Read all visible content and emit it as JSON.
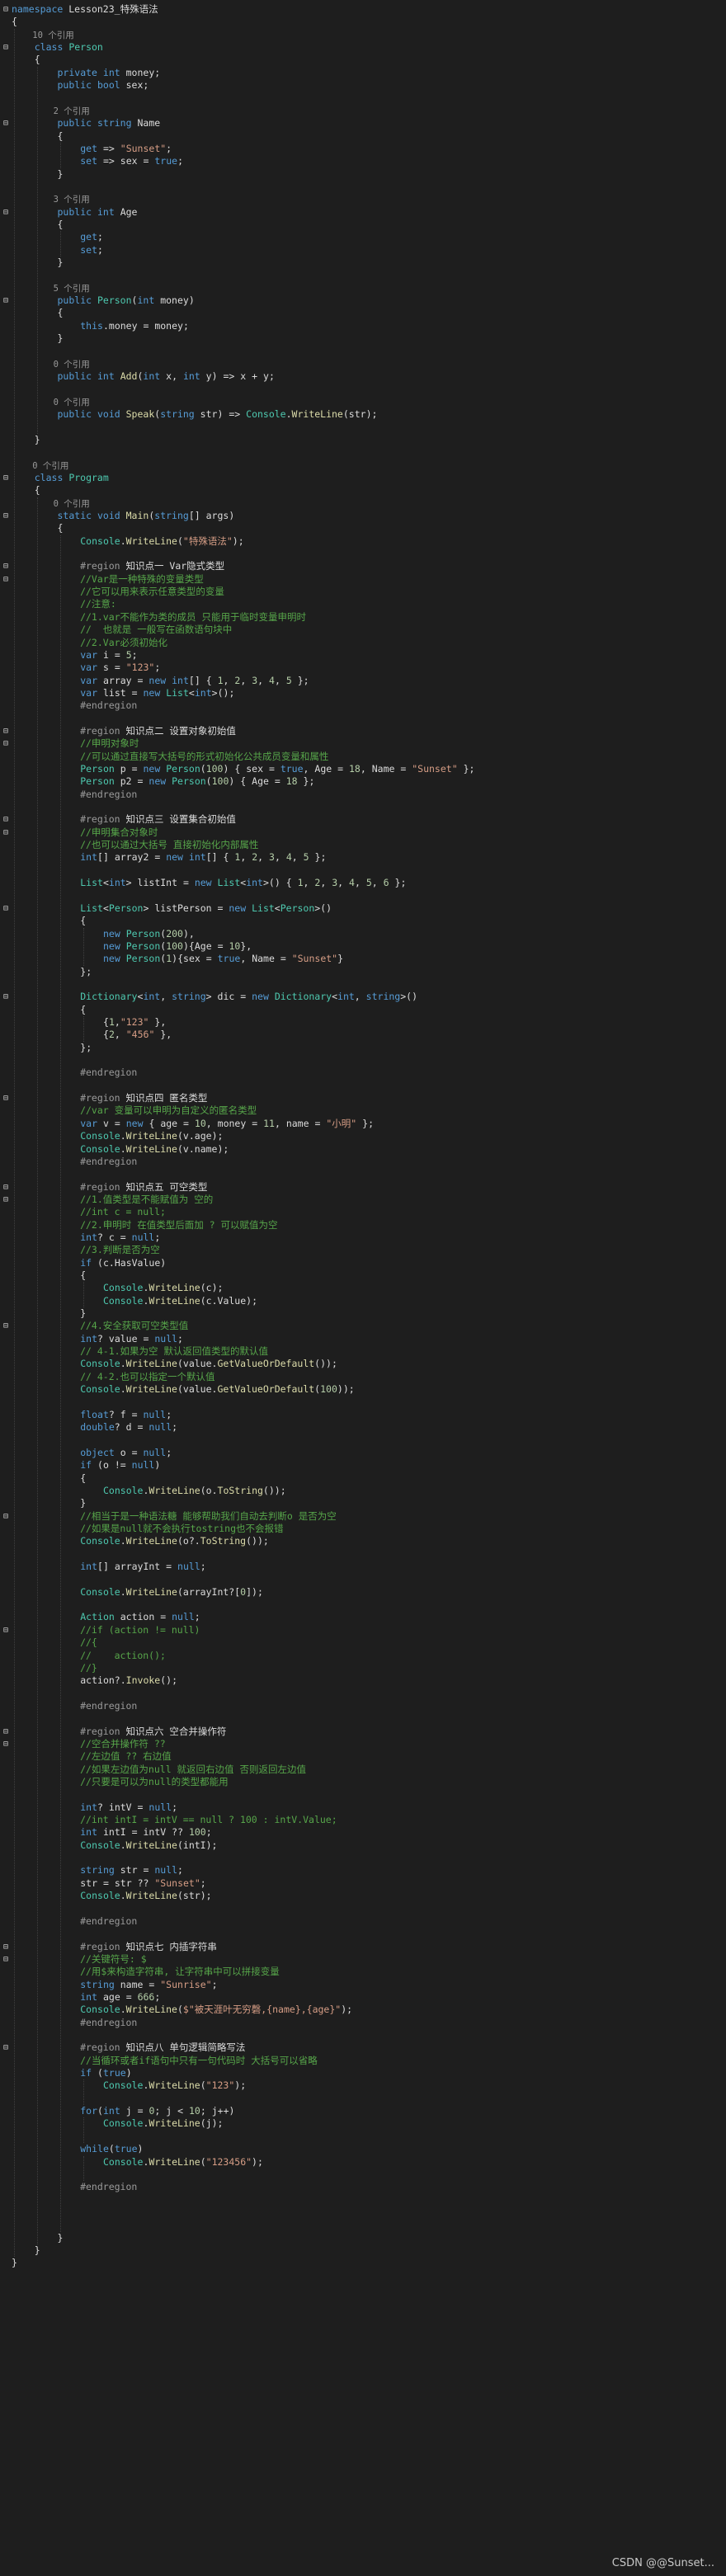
{
  "editor": {
    "theme": "dark",
    "background": "#1e1e1e",
    "lines": [
      {
        "text": "namespace Lesson23_特殊语法",
        "fold": "-"
      },
      {
        "text": "{"
      },
      {
        "text": "    10 个引用",
        "kind": "ref"
      },
      {
        "text": "    class Person",
        "fold": "-"
      },
      {
        "text": "    {"
      },
      {
        "text": "        private int money;"
      },
      {
        "text": "        public bool sex;"
      },
      {
        "text": ""
      },
      {
        "text": "        2 个引用",
        "kind": "ref"
      },
      {
        "text": "        public string Name",
        "fold": "-"
      },
      {
        "text": "        {"
      },
      {
        "text": "            get => \"Sunset\";"
      },
      {
        "text": "            set => sex = true;"
      },
      {
        "text": "        }"
      },
      {
        "text": ""
      },
      {
        "text": "        3 个引用",
        "kind": "ref"
      },
      {
        "text": "        public int Age",
        "fold": "-"
      },
      {
        "text": "        {"
      },
      {
        "text": "            get;"
      },
      {
        "text": "            set;"
      },
      {
        "text": "        }"
      },
      {
        "text": ""
      },
      {
        "text": "        5 个引用",
        "kind": "ref"
      },
      {
        "text": "        public Person(int money)",
        "fold": "-"
      },
      {
        "text": "        {"
      },
      {
        "text": "            this.money = money;"
      },
      {
        "text": "        }"
      },
      {
        "text": ""
      },
      {
        "text": "        0 个引用",
        "kind": "ref"
      },
      {
        "text": "        public int Add(int x, int y) => x + y;"
      },
      {
        "text": ""
      },
      {
        "text": "        0 个引用",
        "kind": "ref"
      },
      {
        "text": "        public void Speak(string str) => Console.WriteLine(str);"
      },
      {
        "text": ""
      },
      {
        "text": "    }"
      },
      {
        "text": ""
      },
      {
        "text": "    0 个引用",
        "kind": "ref"
      },
      {
        "text": "    class Program",
        "fold": "-"
      },
      {
        "text": "    {"
      },
      {
        "text": "        0 个引用",
        "kind": "ref"
      },
      {
        "text": "        static void Main(string[] args)",
        "fold": "-"
      },
      {
        "text": "        {"
      },
      {
        "text": "            Console.WriteLine(\"特殊语法\");"
      },
      {
        "text": ""
      },
      {
        "text": "            #region 知识点一 Var隐式类型",
        "kind": "pp",
        "fold": "-"
      },
      {
        "text": "            //Var是一种特殊的变量类型",
        "kind": "cm",
        "fold": "-"
      },
      {
        "text": "            //它可以用来表示任意类型的变量",
        "kind": "cm"
      },
      {
        "text": "            //注意:",
        "kind": "cm"
      },
      {
        "text": "            //1.var不能作为类的成员 只能用于临时变量申明时",
        "kind": "cm"
      },
      {
        "text": "            //  也就是 一般写在函数语句块中",
        "kind": "cm"
      },
      {
        "text": "            //2.Var必须初始化",
        "kind": "cm"
      },
      {
        "text": "            var i = 5;"
      },
      {
        "text": "            var s = \"123\";"
      },
      {
        "text": "            var array = new int[] { 1, 2, 3, 4, 5 };"
      },
      {
        "text": "            var list = new List<int>();"
      },
      {
        "text": "            #endregion",
        "kind": "pp"
      },
      {
        "text": ""
      },
      {
        "text": "            #region 知识点二 设置对象初始值",
        "kind": "pp",
        "fold": "-"
      },
      {
        "text": "            //申明对象时",
        "kind": "cm",
        "fold": "-"
      },
      {
        "text": "            //可以通过直接写大括号的形式初始化公共成员变量和属性",
        "kind": "cm"
      },
      {
        "text": "            Person p = new Person(100) { sex = true, Age = 18, Name = \"Sunset\" };"
      },
      {
        "text": "            Person p2 = new Person(100) { Age = 18 };"
      },
      {
        "text": "            #endregion",
        "kind": "pp"
      },
      {
        "text": ""
      },
      {
        "text": "            #region 知识点三 设置集合初始值",
        "kind": "pp",
        "fold": "-"
      },
      {
        "text": "            //申明集合对象时",
        "kind": "cm",
        "fold": "-"
      },
      {
        "text": "            //也可以通过大括号 直接初始化内部属性",
        "kind": "cm"
      },
      {
        "text": "            int[] array2 = new int[] { 1, 2, 3, 4, 5 };"
      },
      {
        "text": ""
      },
      {
        "text": "            List<int> listInt = new List<int>() { 1, 2, 3, 4, 5, 6 };"
      },
      {
        "text": ""
      },
      {
        "text": "            List<Person> listPerson = new List<Person>()",
        "fold": "-"
      },
      {
        "text": "            {"
      },
      {
        "text": "                new Person(200),"
      },
      {
        "text": "                new Person(100){Age = 10},"
      },
      {
        "text": "                new Person(1){sex = true, Name = \"Sunset\"}"
      },
      {
        "text": "            };"
      },
      {
        "text": ""
      },
      {
        "text": "            Dictionary<int, string> dic = new Dictionary<int, string>()",
        "fold": "-"
      },
      {
        "text": "            {"
      },
      {
        "text": "                {1,\"123\" },"
      },
      {
        "text": "                {2, \"456\" },"
      },
      {
        "text": "            };"
      },
      {
        "text": ""
      },
      {
        "text": "            #endregion",
        "kind": "pp"
      },
      {
        "text": ""
      },
      {
        "text": "            #region 知识点四 匿名类型",
        "kind": "pp",
        "fold": "-"
      },
      {
        "text": "            //var 变量可以申明为自定义的匿名类型",
        "kind": "cm"
      },
      {
        "text": "            var v = new { age = 10, money = 11, name = \"小明\" };"
      },
      {
        "text": "            Console.WriteLine(v.age);"
      },
      {
        "text": "            Console.WriteLine(v.name);"
      },
      {
        "text": "            #endregion",
        "kind": "pp"
      },
      {
        "text": ""
      },
      {
        "text": "            #region 知识点五 可空类型",
        "kind": "pp",
        "fold": "-"
      },
      {
        "text": "            //1.值类型是不能赋值为 空的",
        "kind": "cm",
        "fold": "-"
      },
      {
        "text": "            //int c = null;",
        "kind": "cm"
      },
      {
        "text": "            //2.申明时 在值类型后面加 ? 可以赋值为空",
        "kind": "cm"
      },
      {
        "text": "            int? c = null;"
      },
      {
        "text": "            //3.判断是否为空",
        "kind": "cm"
      },
      {
        "text": "            if (c.HasValue)"
      },
      {
        "text": "            {"
      },
      {
        "text": "                Console.WriteLine(c);"
      },
      {
        "text": "                Console.WriteLine(c.Value);"
      },
      {
        "text": "            }"
      },
      {
        "text": "            //4.安全获取可空类型值",
        "kind": "cm",
        "fold": "-"
      },
      {
        "text": "            int? value = null;"
      },
      {
        "text": "            // 4-1.如果为空 默认返回值类型的默认值",
        "kind": "cm"
      },
      {
        "text": "            Console.WriteLine(value.GetValueOrDefault());"
      },
      {
        "text": "            // 4-2.也可以指定一个默认值",
        "kind": "cm"
      },
      {
        "text": "            Console.WriteLine(value.GetValueOrDefault(100));"
      },
      {
        "text": ""
      },
      {
        "text": "            float? f = null;"
      },
      {
        "text": "            double? d = null;"
      },
      {
        "text": ""
      },
      {
        "text": "            object o = null;"
      },
      {
        "text": "            if (o != null)"
      },
      {
        "text": "            {"
      },
      {
        "text": "                Console.WriteLine(o.ToString());"
      },
      {
        "text": "            }"
      },
      {
        "text": "            //相当于是一种语法糖 能够帮助我们自动去判断o 是否为空",
        "kind": "cm",
        "fold": "-"
      },
      {
        "text": "            //如果是null就不会执行tostring也不会报错",
        "kind": "cm"
      },
      {
        "text": "            Console.WriteLine(o?.ToString());"
      },
      {
        "text": ""
      },
      {
        "text": "            int[] arrayInt = null;"
      },
      {
        "text": ""
      },
      {
        "text": "            Console.WriteLine(arrayInt?[0]);"
      },
      {
        "text": ""
      },
      {
        "text": "            Action action = null;"
      },
      {
        "text": "            //if (action != null)",
        "kind": "cm",
        "fold": "-"
      },
      {
        "text": "            //{",
        "kind": "cm"
      },
      {
        "text": "            //    action();",
        "kind": "cm"
      },
      {
        "text": "            //}",
        "kind": "cm"
      },
      {
        "text": "            action?.Invoke();"
      },
      {
        "text": ""
      },
      {
        "text": "            #endregion",
        "kind": "pp"
      },
      {
        "text": ""
      },
      {
        "text": "            #region 知识点六 空合并操作符",
        "kind": "pp",
        "fold": "-"
      },
      {
        "text": "            //空合并操作符 ??",
        "kind": "cm",
        "fold": "-"
      },
      {
        "text": "            //左边值 ?? 右边值",
        "kind": "cm"
      },
      {
        "text": "            //如果左边值为null 就返回右边值 否则返回左边值",
        "kind": "cm"
      },
      {
        "text": "            //只要是可以为null的类型都能用",
        "kind": "cm"
      },
      {
        "text": ""
      },
      {
        "text": "            int? intV = null;"
      },
      {
        "text": "            //int intI = intV == null ? 100 : intV.Value;",
        "kind": "cm"
      },
      {
        "text": "            int intI = intV ?? 100;"
      },
      {
        "text": "            Console.WriteLine(intI);"
      },
      {
        "text": ""
      },
      {
        "text": "            string str = null;"
      },
      {
        "text": "            str = str ?? \"Sunset\";"
      },
      {
        "text": "            Console.WriteLine(str);"
      },
      {
        "text": ""
      },
      {
        "text": "            #endregion",
        "kind": "pp"
      },
      {
        "text": ""
      },
      {
        "text": "            #region 知识点七 内插字符串",
        "kind": "pp",
        "fold": "-"
      },
      {
        "text": "            //关键符号: $",
        "kind": "cm",
        "fold": "-"
      },
      {
        "text": "            //用$来构造字符串, 让字符串中可以拼接变量",
        "kind": "cm"
      },
      {
        "text": "            string name = \"Sunrise\";"
      },
      {
        "text": "            int age = 666;"
      },
      {
        "text": "            Console.WriteLine($\"被天涯叶无穷磬,{name},{age}\");"
      },
      {
        "text": "            #endregion",
        "kind": "pp"
      },
      {
        "text": ""
      },
      {
        "text": "            #region 知识点八 单句逻辑简略写法",
        "kind": "pp",
        "fold": "-"
      },
      {
        "text": "            //当循环或者if语句中只有一句代码时 大括号可以省略",
        "kind": "cm"
      },
      {
        "text": "            if (true)"
      },
      {
        "text": "                Console.WriteLine(\"123\");"
      },
      {
        "text": ""
      },
      {
        "text": "            for(int j = 0; j < 10; j++)"
      },
      {
        "text": "                Console.WriteLine(j);"
      },
      {
        "text": ""
      },
      {
        "text": "            while(true)"
      },
      {
        "text": "                Console.WriteLine(\"123456\");"
      },
      {
        "text": ""
      },
      {
        "text": "            #endregion",
        "kind": "pp"
      },
      {
        "text": ""
      },
      {
        "text": ""
      },
      {
        "text": ""
      },
      {
        "text": "        }"
      },
      {
        "text": "    }"
      },
      {
        "text": "}"
      }
    ]
  },
  "watermark": "CSDN @@Sunset..."
}
